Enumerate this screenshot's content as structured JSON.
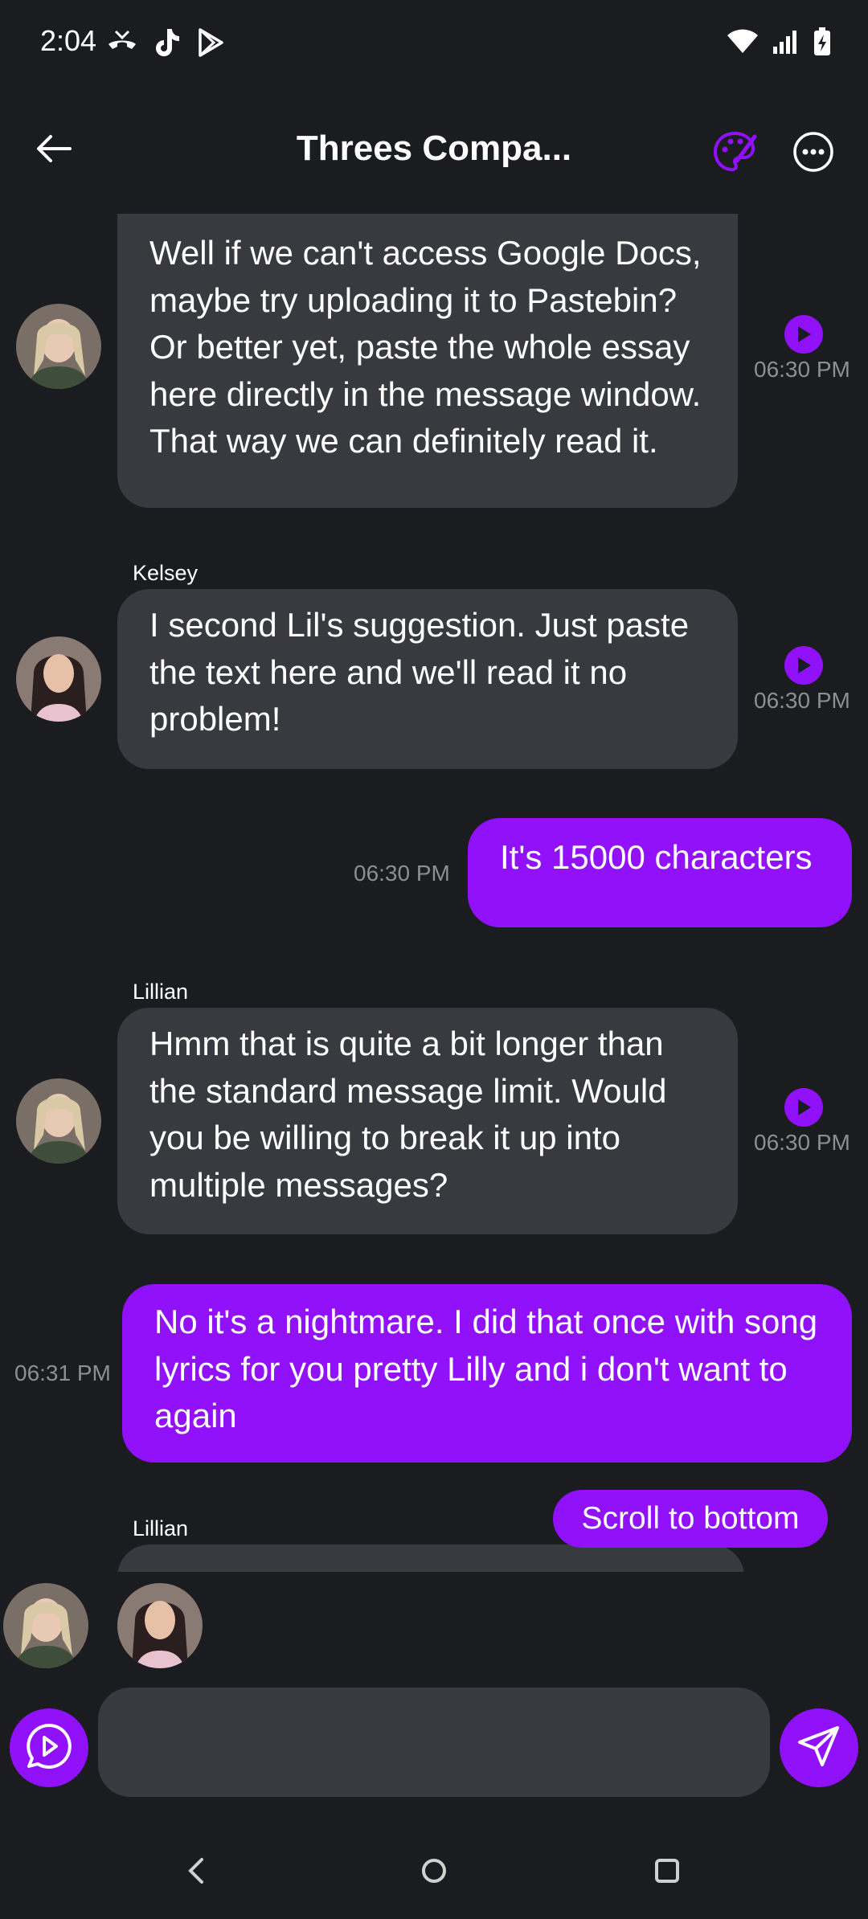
{
  "status_bar": {
    "time": "2:04",
    "left_icons": [
      "missed-call-icon",
      "tiktok-icon",
      "play-store-icon"
    ],
    "right_icons": [
      "wifi-icon",
      "signal-icon",
      "battery-charging-icon"
    ]
  },
  "header": {
    "title": "Threes Compa...",
    "icons": [
      "back-arrow-icon",
      "palette-icon",
      "more-options-icon"
    ]
  },
  "messages": [
    {
      "sender": "",
      "direction": "incoming",
      "text": "Well if we can't access Google Docs, maybe try uploading it to Pastebin? Or better yet, paste the whole essay here directly in the message window. That way we can definitely read it.",
      "time": "06:30 PM",
      "has_audio": true
    },
    {
      "sender": "Kelsey",
      "direction": "incoming",
      "text": "I second Lil's suggestion. Just paste the text here and we'll read it no problem!",
      "time": "06:30 PM",
      "has_audio": true
    },
    {
      "sender": "",
      "direction": "outgoing",
      "text": "It's 15000 characters",
      "time": "06:30 PM"
    },
    {
      "sender": "Lillian",
      "direction": "incoming",
      "text": "Hmm that is quite a bit longer than the standard message limit. Would you be willing to break it up into multiple messages?",
      "time": "06:30 PM",
      "has_audio": true
    },
    {
      "sender": "",
      "direction": "outgoing",
      "text": "No it's a nightmare. I did that once with song lyrics for you pretty Lilly and i don't want to again",
      "time": "06:31 PM"
    },
    {
      "sender": "Lillian",
      "direction": "incoming",
      "text": "",
      "time": ""
    }
  ],
  "scroll_button": "Scroll to bottom",
  "composer": {
    "placeholder": "",
    "icons": [
      "voice-message-icon",
      "send-icon"
    ]
  },
  "nav_bar": [
    "back-nav-icon",
    "home-nav-icon",
    "recents-nav-icon"
  ],
  "colors": {
    "background": "#1b1c20",
    "incoming_bubble": "#393a40",
    "outgoing_bubble": "#9011fa",
    "accent": "#9011fa",
    "timestamp": "#8d8e93"
  }
}
